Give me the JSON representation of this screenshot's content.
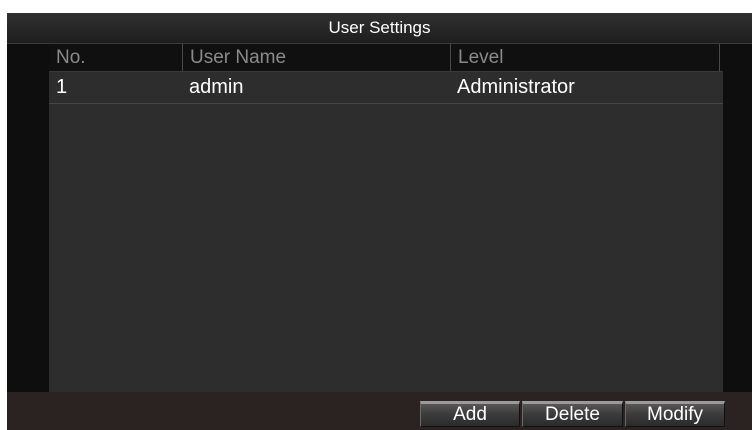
{
  "dialog": {
    "title": "User Settings"
  },
  "table": {
    "columns": [
      "No.",
      "User Name",
      "Level"
    ],
    "rows": [
      {
        "no": "1",
        "user_name": "admin",
        "level": "Administrator"
      }
    ]
  },
  "buttons": {
    "add": "Add",
    "delete": "Delete",
    "modify": "Modify"
  }
}
